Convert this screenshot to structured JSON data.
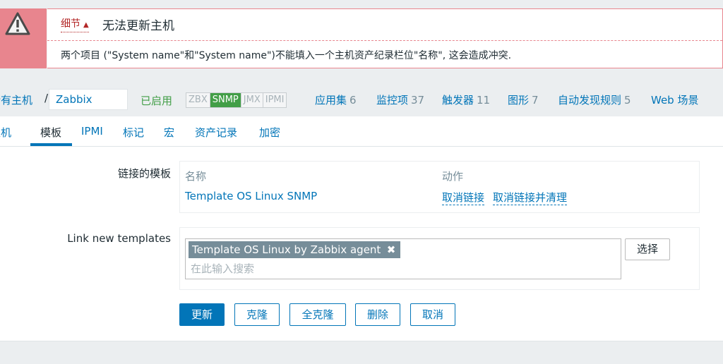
{
  "message": {
    "details_label": "细节",
    "caret": "▲",
    "title": "无法更新主机",
    "text": "两个项目 (\"System name\"和\"System name\")不能填入一个主机资产纪录栏位\"名称\", 这会造成冲突."
  },
  "breadcrumbs": {
    "all_hosts": "所有主机",
    "separator": "/",
    "current_host": "Zabbix server",
    "status": "已启用",
    "availability": [
      "ZBX",
      "SNMP",
      "JMX",
      "IPMI"
    ],
    "links": [
      {
        "label": "应用集",
        "count": "6"
      },
      {
        "label": "监控项",
        "count": "37"
      },
      {
        "label": "触发器",
        "count": "11"
      },
      {
        "label": "图形",
        "count": "7"
      },
      {
        "label": "自动发现规则",
        "count": "5"
      },
      {
        "label": "Web 场景",
        "count": ""
      }
    ]
  },
  "tabs": [
    "主机",
    "模板",
    "IPMI",
    "标记",
    "宏",
    "资产记录",
    "加密"
  ],
  "active_tab": "模板",
  "linked_templates": {
    "label": "链接的模板",
    "col_name": "名称",
    "col_action": "动作",
    "rows": [
      {
        "name": "Template OS Linux SNMP",
        "unlink": "取消链接",
        "unlink_clear": "取消链接并清理"
      }
    ]
  },
  "link_new": {
    "label": "Link new templates",
    "chip": "Template OS Linux by Zabbix agent",
    "placeholder": "在此输入搜索",
    "select_button": "选择"
  },
  "buttons": {
    "update": "更新",
    "clone": "克隆",
    "full_clone": "全克隆",
    "delete": "删除",
    "cancel": "取消"
  },
  "colors": {
    "accent": "#0275b8",
    "error": "#e8858e",
    "enabled": "#429e47"
  }
}
